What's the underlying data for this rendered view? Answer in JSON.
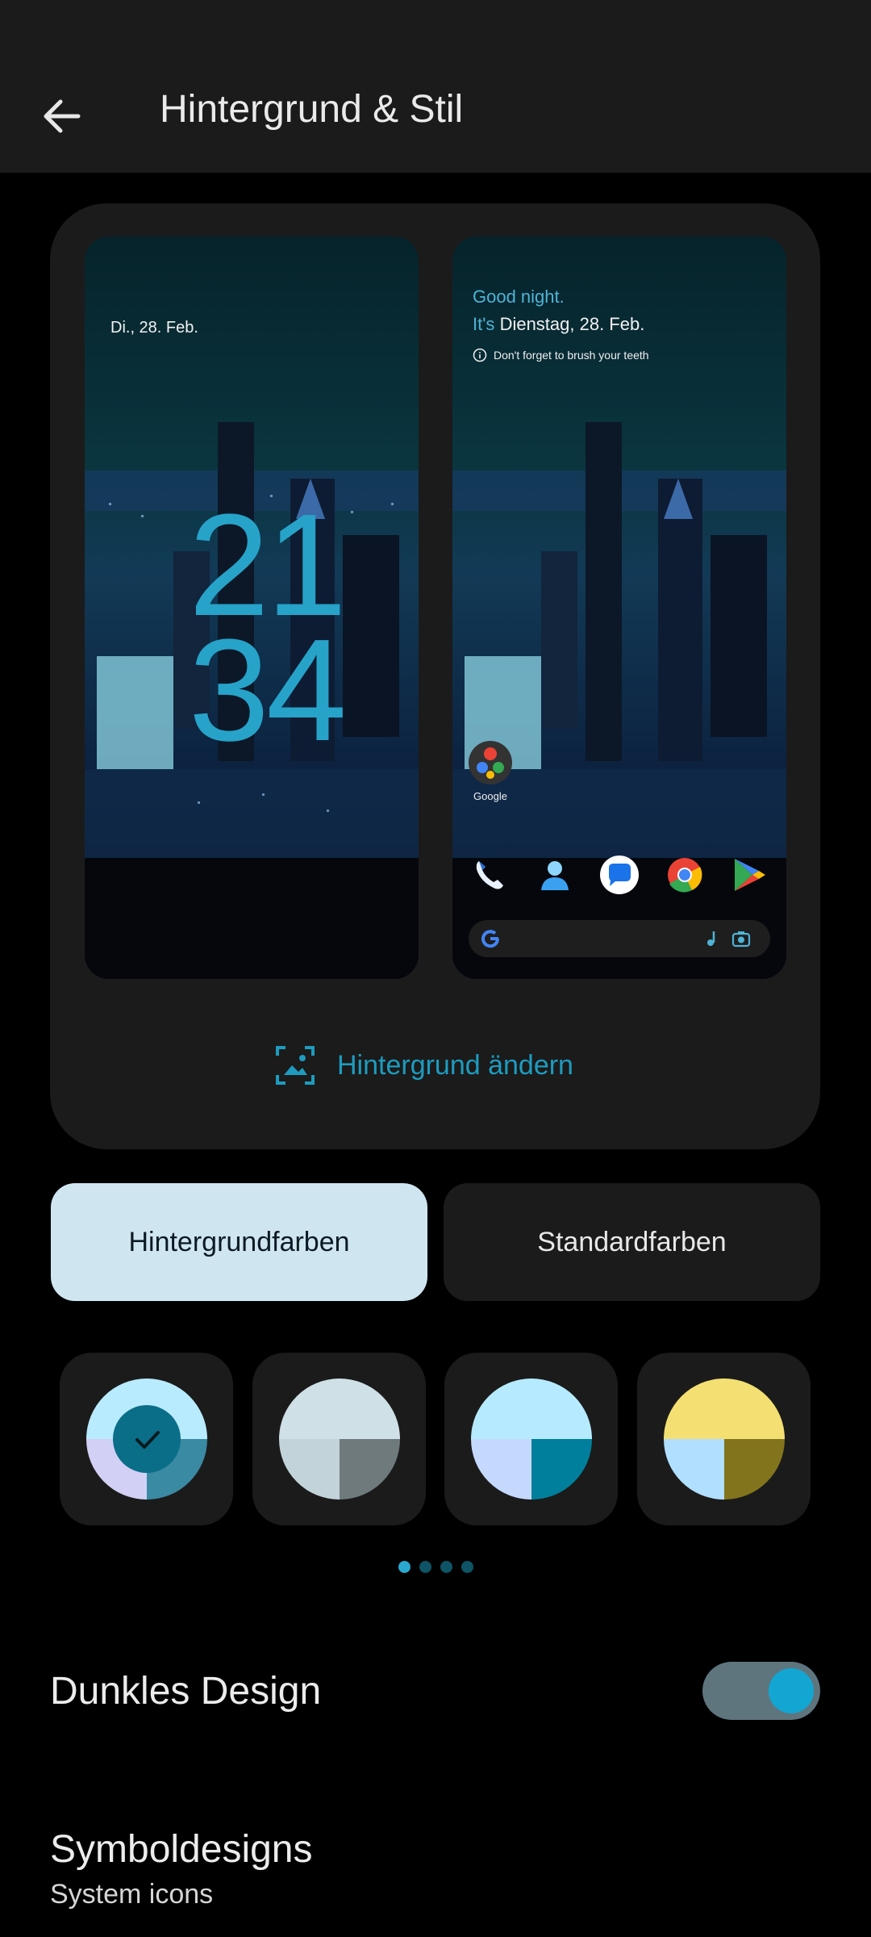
{
  "appbar": {
    "title": "Hintergrund & Stil",
    "back_icon": "arrow-left-icon"
  },
  "preview": {
    "lock": {
      "date": "Di., 28. Feb.",
      "clock_hours": "21",
      "clock_minutes": "34"
    },
    "home": {
      "greeting": "Good night.",
      "its_prefix": "It's",
      "date": "Dienstag, 28. Feb.",
      "reminder": "Don't forget to brush your teeth",
      "folder_label": "Google",
      "dock_icons": [
        "phone-icon",
        "contacts-icon",
        "messages-icon",
        "chrome-icon",
        "play-store-icon"
      ]
    },
    "change_wallpaper_label": "Hintergrund ändern"
  },
  "tabs": {
    "wallpaper_colors": "Hintergrundfarben",
    "default_colors": "Standardfarben"
  },
  "swatches": [
    {
      "top": "#b9ebff",
      "bottom_left": "#d3d0f5",
      "bottom_right": "#3a8aa3",
      "selected": true
    },
    {
      "top": "#cfe0e6",
      "bottom_left": "#c3d3da",
      "bottom_right": "#6f7a7d",
      "selected": false
    },
    {
      "top": "#b6ebff",
      "bottom_left": "#c5d9ff",
      "bottom_right": "#007f9c",
      "selected": false
    },
    {
      "top": "#f4df73",
      "bottom_left": "#b0dfff",
      "bottom_right": "#82741c",
      "selected": false
    }
  ],
  "page_dots": 4,
  "settings": {
    "dark_theme": {
      "label": "Dunkles Design",
      "enabled": true
    },
    "icon_designs": {
      "label": "Symboldesigns",
      "subtitle": "System icons"
    }
  },
  "colors": {
    "accent": "#1d9cbf",
    "surface": "#1b1b1b",
    "background": "#000000"
  }
}
